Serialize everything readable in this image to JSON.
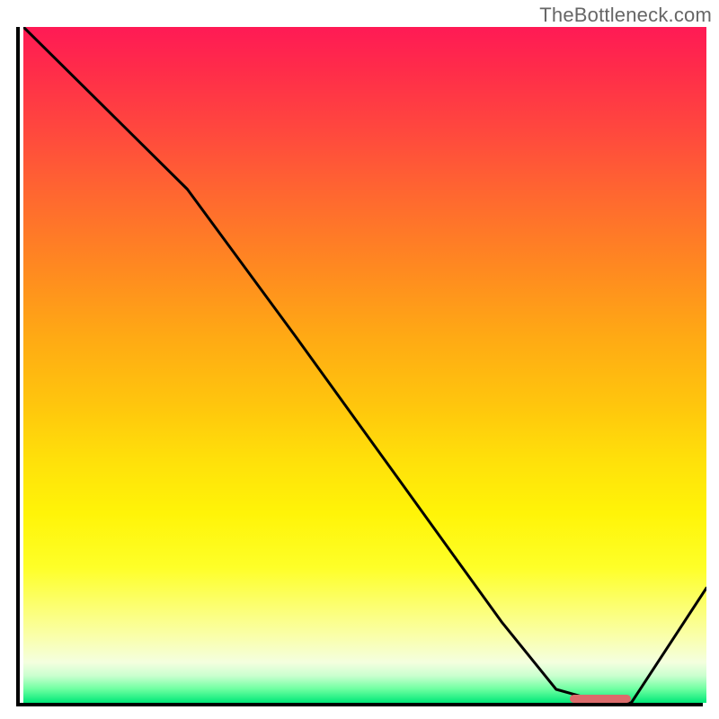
{
  "attribution": "TheBottleneck.com",
  "chart_data": {
    "type": "line",
    "title": "",
    "xlabel": "",
    "ylabel": "",
    "xlim": [
      0,
      100
    ],
    "ylim": [
      0,
      100
    ],
    "grid": false,
    "legend": false,
    "series": [
      {
        "name": "curve",
        "x": [
          0,
          10,
          24,
          40,
          55,
          70,
          78,
          85,
          89,
          100
        ],
        "y": [
          100,
          90,
          76,
          54,
          33,
          12,
          2,
          0,
          0,
          17
        ]
      }
    ],
    "optimal_marker": {
      "x_start": 80,
      "x_end": 89,
      "y": 0
    },
    "gradient_stops": [
      {
        "pos": 0,
        "color": "#ff1a55"
      },
      {
        "pos": 50,
        "color": "#ffc60d"
      },
      {
        "pos": 80,
        "color": "#feff28"
      },
      {
        "pos": 100,
        "color": "#00e878"
      }
    ]
  }
}
